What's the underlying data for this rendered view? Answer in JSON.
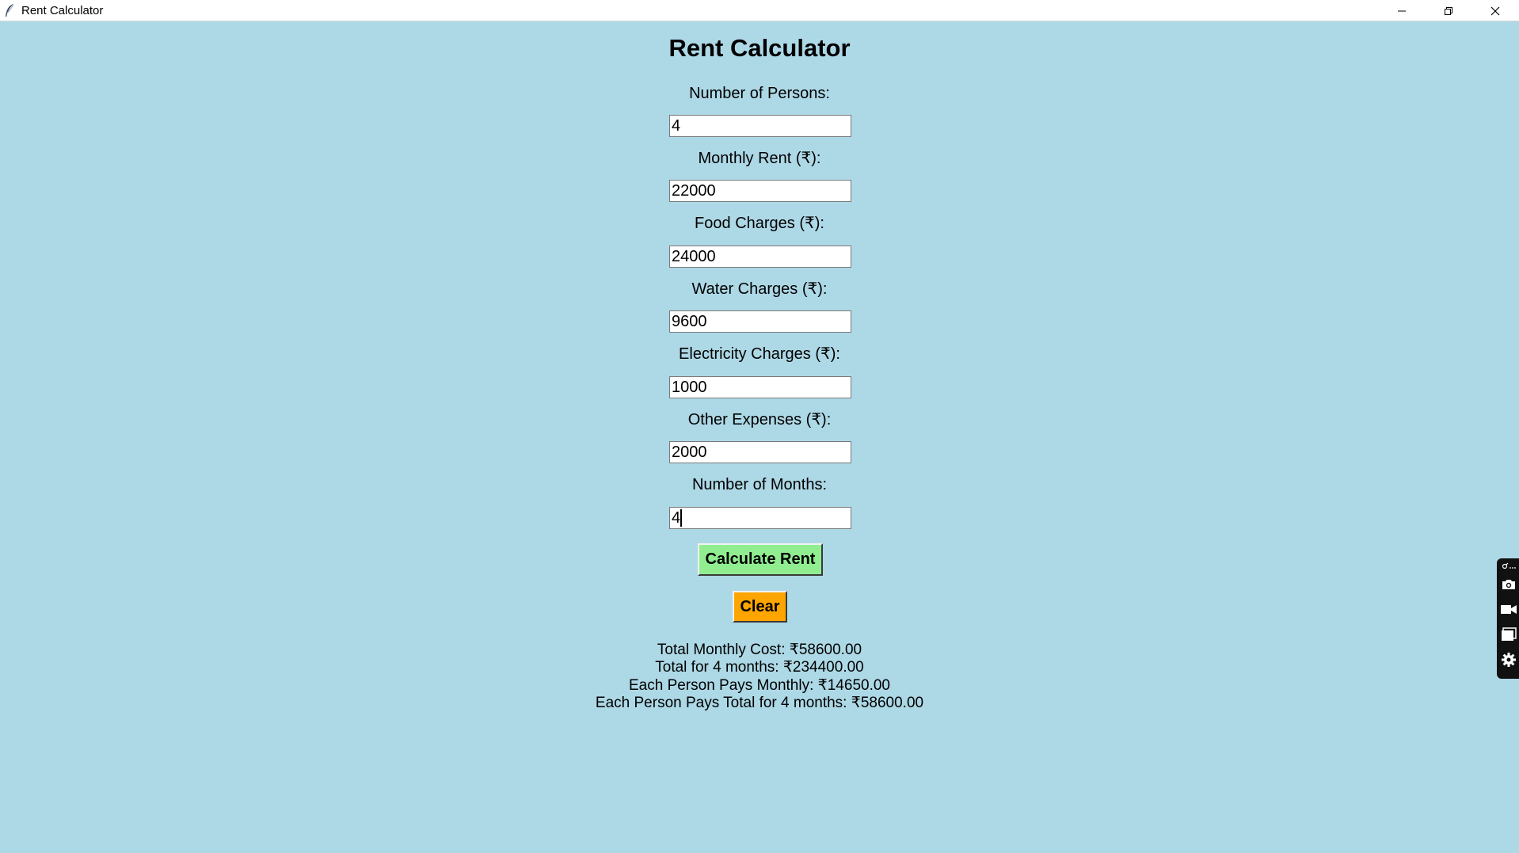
{
  "window": {
    "title": "Rent Calculator",
    "controls": [
      "minimize",
      "restore",
      "close"
    ]
  },
  "app": {
    "heading": "Rent Calculator",
    "fields": [
      {
        "label": "Number of Persons:",
        "value": "4"
      },
      {
        "label": "Monthly Rent (₹):",
        "value": "22000"
      },
      {
        "label": "Food Charges (₹):",
        "value": "24000"
      },
      {
        "label": "Water Charges (₹):",
        "value": "9600"
      },
      {
        "label": "Electricity Charges (₹):",
        "value": "1000"
      },
      {
        "label": "Other Expenses (₹):",
        "value": "2000"
      },
      {
        "label": "Number of Months:",
        "value": "4"
      }
    ],
    "calculate_label": "Calculate Rent",
    "clear_label": "Clear",
    "results": [
      "Total Monthly Cost: ₹58600.00",
      "Total for 4 months: ₹234400.00",
      "Each Person Pays Monthly: ₹14650.00",
      "Each Person Pays Total for 4 months: ₹58600.00"
    ]
  },
  "side_toolbar": {
    "items": [
      "pin-icon",
      "camera-icon",
      "video-camera-icon",
      "window-icon",
      "gear-icon"
    ]
  },
  "colors": {
    "background": "#add8e6",
    "calculate_button": "#90ee90",
    "clear_button": "#ffa500"
  }
}
